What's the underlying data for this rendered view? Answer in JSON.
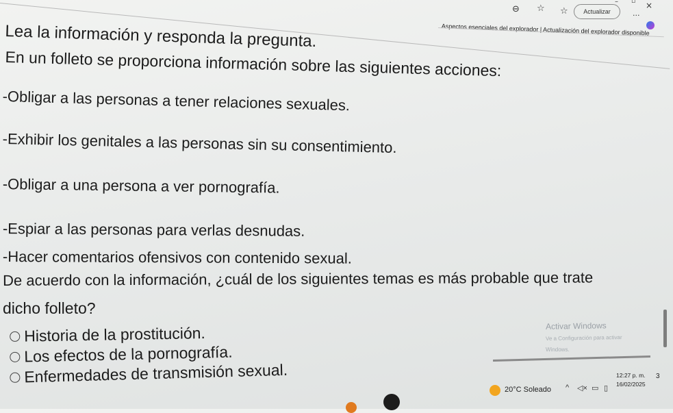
{
  "browser": {
    "update_button_label": "Actualizar",
    "update_banner": "Aspectos esenciales del explorador | Actualización del explorador disponible",
    "icons": [
      "account-icon",
      "favorite-star-icon",
      "favorites-list-icon",
      "more-options-icon",
      "minimize-icon",
      "maximize-icon",
      "close-icon",
      "copilot-icon"
    ],
    "more_label": "...",
    "close_label": "×"
  },
  "question": {
    "instruction": "Lea la información y responda la pregunta.",
    "intro": "En un folleto se proporciona información sobre las siguientes acciones:",
    "actions": [
      "-Obligar a las personas a tener relaciones sexuales.",
      "-Exhibir los genitales a las personas sin su consentimiento.",
      "-Obligar a una persona a ver pornografía.",
      "-Espiar a las personas para verlas desnudas.",
      "-Hacer comentarios ofensivos con contenido sexual."
    ],
    "prompt_line1": "De acuerdo con la información, ¿cuál de los siguientes temas es más probable que trate",
    "prompt_line2": "dicho folleto?",
    "options": [
      "Historia de la prostitución.",
      "Los efectos de la pornografía.",
      "Enfermedades de transmisión sexual."
    ]
  },
  "watermark": {
    "title": "Activar Windows",
    "line1": "Ve a Configuración para activar",
    "line2": "Windows."
  },
  "taskbar": {
    "weather": "20°C  Soleado",
    "time": "12:27 p. m.",
    "date": "16/02/2025",
    "notification_count": "3"
  },
  "colors": {
    "text": "#1c1c1c",
    "background": "#eceeed",
    "watermark": "#9aa0a6",
    "sun": "#f2a51f"
  }
}
